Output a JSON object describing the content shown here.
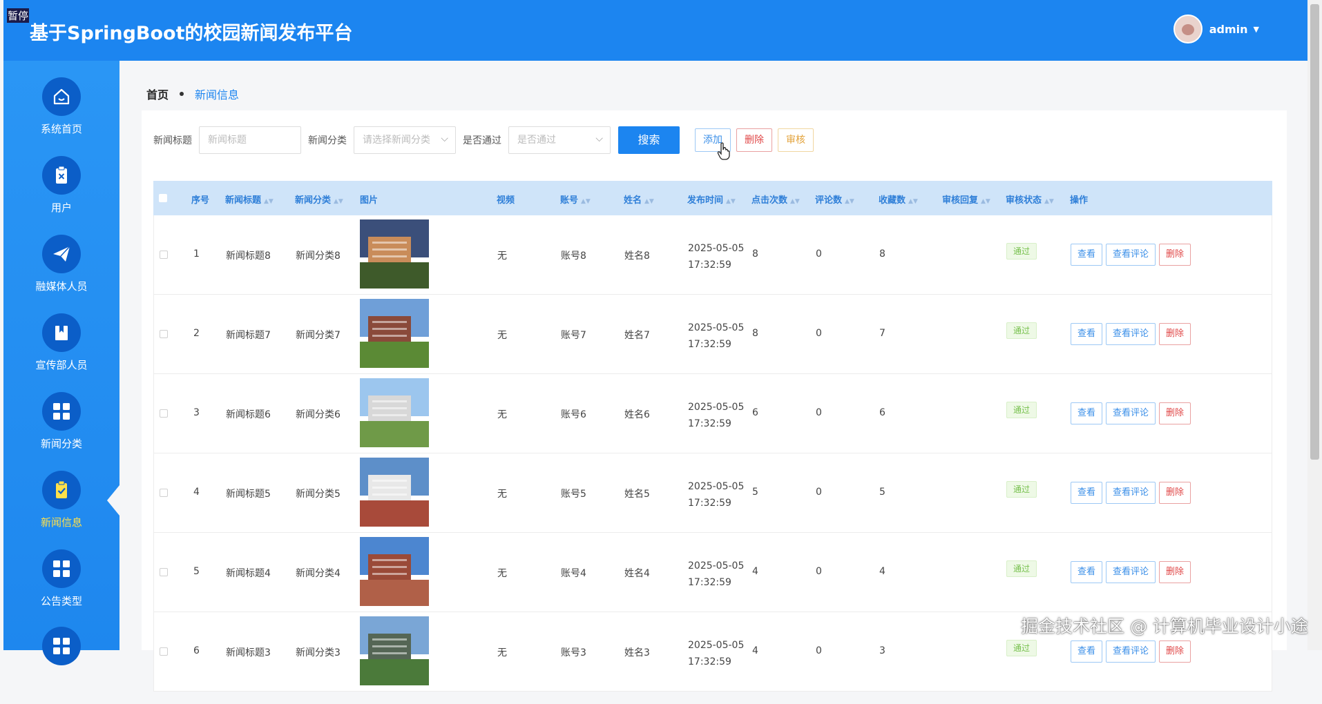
{
  "overlay": {
    "paused_label": "暂停"
  },
  "header": {
    "title": "基于SpringBoot的校园新闻发布平台",
    "username": "admin"
  },
  "sidebar": {
    "items": [
      {
        "label": "系统首页",
        "icon": "home-icon",
        "active": false
      },
      {
        "label": "用户",
        "icon": "clipboard-x-icon",
        "active": false
      },
      {
        "label": "融媒体人员",
        "icon": "paper-plane-icon",
        "active": false
      },
      {
        "label": "宣传部人员",
        "icon": "book-icon",
        "active": false
      },
      {
        "label": "新闻分类",
        "icon": "grid-icon",
        "active": false
      },
      {
        "label": "新闻信息",
        "icon": "clipboard-check-icon",
        "active": true
      },
      {
        "label": "公告类型",
        "icon": "grid-icon",
        "active": false
      }
    ]
  },
  "breadcrumb": {
    "home": "首页",
    "current": "新闻信息"
  },
  "search": {
    "title_label": "新闻标题",
    "title_placeholder": "新闻标题",
    "category_label": "新闻分类",
    "category_placeholder": "请选择新闻分类",
    "approved_label": "是否通过",
    "approved_placeholder": "是否通过",
    "search_button": "搜索",
    "add_button": "添加",
    "delete_button": "删除",
    "review_button": "审核"
  },
  "table": {
    "headers": {
      "index": "序号",
      "title": "新闻标题",
      "category": "新闻分类",
      "image": "图片",
      "video": "视频",
      "account": "账号",
      "name": "姓名",
      "time": "发布时间",
      "clicks": "点击次数",
      "comments": "评论数",
      "favorites": "收藏数",
      "reply": "审核回复",
      "status": "审核状态",
      "actions": "操作"
    },
    "action_labels": {
      "view": "查看",
      "view_comments": "查看评论",
      "delete": "删除"
    },
    "rows": [
      {
        "index": "1",
        "title": "新闻标题8",
        "category": "新闻分类8",
        "video": "无",
        "account": "账号8",
        "name": "姓名8",
        "date": "2025-05-05",
        "time": "17:32:59",
        "clicks": "8",
        "comments": "0",
        "favorites": "8",
        "reply": "",
        "status": "通过"
      },
      {
        "index": "2",
        "title": "新闻标题7",
        "category": "新闻分类7",
        "video": "无",
        "account": "账号7",
        "name": "姓名7",
        "date": "2025-05-05",
        "time": "17:32:59",
        "clicks": "8",
        "comments": "0",
        "favorites": "7",
        "reply": "",
        "status": "通过"
      },
      {
        "index": "3",
        "title": "新闻标题6",
        "category": "新闻分类6",
        "video": "无",
        "account": "账号6",
        "name": "姓名6",
        "date": "2025-05-05",
        "time": "17:32:59",
        "clicks": "6",
        "comments": "0",
        "favorites": "6",
        "reply": "",
        "status": "通过"
      },
      {
        "index": "4",
        "title": "新闻标题5",
        "category": "新闻分类5",
        "video": "无",
        "account": "账号5",
        "name": "姓名5",
        "date": "2025-05-05",
        "time": "17:32:59",
        "clicks": "5",
        "comments": "0",
        "favorites": "5",
        "reply": "",
        "status": "通过"
      },
      {
        "index": "5",
        "title": "新闻标题4",
        "category": "新闻分类4",
        "video": "无",
        "account": "账号4",
        "name": "姓名4",
        "date": "2025-05-05",
        "time": "17:32:59",
        "clicks": "4",
        "comments": "0",
        "favorites": "4",
        "reply": "",
        "status": "通过"
      },
      {
        "index": "6",
        "title": "新闻标题3",
        "category": "新闻分类3",
        "video": "无",
        "account": "账号3",
        "name": "姓名3",
        "date": "2025-05-05",
        "time": "17:32:59",
        "clicks": "4",
        "comments": "0",
        "favorites": "3",
        "reply": "",
        "status": "通过"
      }
    ]
  },
  "watermark": "掘金技术社区 @ 计算机毕业设计小途"
}
